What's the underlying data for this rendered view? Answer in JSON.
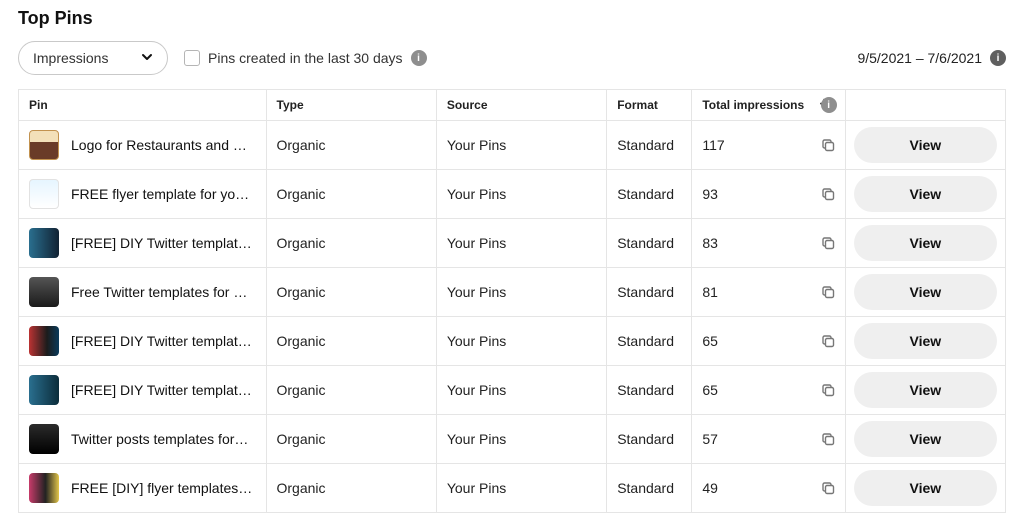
{
  "title": "Top Pins",
  "filter": {
    "metric": "Impressions",
    "checkbox_label": "Pins created in the last 30 days"
  },
  "date_range": "9/5/2021 – 7/6/2021",
  "columns": {
    "pin": "Pin",
    "type": "Type",
    "source": "Source",
    "format": "Format",
    "impressions": "Total impressions",
    "view_btn": "View"
  },
  "rows": [
    {
      "title": "Logo for Restaurants and …",
      "type": "Organic",
      "source": "Your Pins",
      "format": "Standard",
      "impressions": "117",
      "thumb": "t0"
    },
    {
      "title": "FREE flyer template for yo…",
      "type": "Organic",
      "source": "Your Pins",
      "format": "Standard",
      "impressions": "93",
      "thumb": "t1"
    },
    {
      "title": "[FREE] DIY Twitter templat…",
      "type": "Organic",
      "source": "Your Pins",
      "format": "Standard",
      "impressions": "83",
      "thumb": "t2"
    },
    {
      "title": "Free Twitter templates for …",
      "type": "Organic",
      "source": "Your Pins",
      "format": "Standard",
      "impressions": "81",
      "thumb": "t3"
    },
    {
      "title": "[FREE] DIY Twitter templat…",
      "type": "Organic",
      "source": "Your Pins",
      "format": "Standard",
      "impressions": "65",
      "thumb": "t4"
    },
    {
      "title": "[FREE] DIY Twitter templat…",
      "type": "Organic",
      "source": "Your Pins",
      "format": "Standard",
      "impressions": "65",
      "thumb": "t5"
    },
    {
      "title": "Twitter posts templates for…",
      "type": "Organic",
      "source": "Your Pins",
      "format": "Standard",
      "impressions": "57",
      "thumb": "t6"
    },
    {
      "title": "FREE [DIY] flyer templates …",
      "type": "Organic",
      "source": "Your Pins",
      "format": "Standard",
      "impressions": "49",
      "thumb": "t7"
    }
  ]
}
